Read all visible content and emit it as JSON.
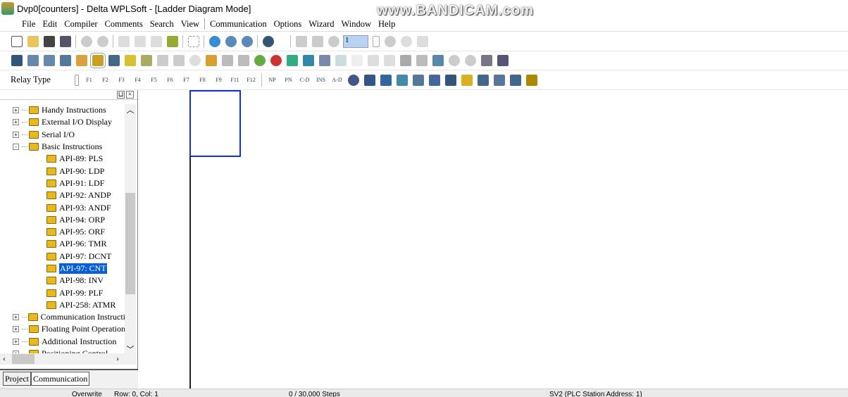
{
  "window": {
    "title": "Dvp0[counters] - Delta WPLSoft - [Ladder Diagram Mode]",
    "watermark": "www.BANDICAM.com"
  },
  "menu": [
    "File",
    "Edit",
    "Compiler",
    "Comments",
    "Search",
    "View",
    "Communication",
    "Options",
    "Wizard",
    "Window",
    "Help"
  ],
  "toolbar": {
    "step_value": "1",
    "relay_type": "Relay Type",
    "fkeys": [
      "F1",
      "F2",
      "F3",
      "F4",
      "F5",
      "F6",
      "F7",
      "F8",
      "F9",
      "F11",
      "F12"
    ],
    "extra_keys": [
      "NP",
      "PN",
      "C-D",
      "INS",
      "A-D"
    ]
  },
  "tree": {
    "items": [
      {
        "label": "Handy Instructions",
        "level": 0,
        "exp": "+"
      },
      {
        "label": "External I/O Display",
        "level": 0,
        "exp": "+"
      },
      {
        "label": "Serial I/O",
        "level": 0,
        "exp": "+"
      },
      {
        "label": "Basic Instructions",
        "level": 0,
        "exp": "-"
      },
      {
        "label": "API-89: PLS",
        "level": 1
      },
      {
        "label": "API-90: LDP",
        "level": 1
      },
      {
        "label": "API-91: LDF",
        "level": 1
      },
      {
        "label": "API-92: ANDP",
        "level": 1
      },
      {
        "label": "API-93: ANDF",
        "level": 1
      },
      {
        "label": "API-94: ORP",
        "level": 1
      },
      {
        "label": "API-95: ORF",
        "level": 1
      },
      {
        "label": "API-96: TMR",
        "level": 1
      },
      {
        "label": "API-97: DCNT",
        "level": 1
      },
      {
        "label": "API-97: CNT",
        "level": 1,
        "selected": true
      },
      {
        "label": "API-98: INV",
        "level": 1
      },
      {
        "label": "API-99: PLF",
        "level": 1
      },
      {
        "label": "API-258: ATMR",
        "level": 1
      },
      {
        "label": "Communication Instructi",
        "level": 0,
        "exp": "+"
      },
      {
        "label": "Floating Point Operation",
        "level": 0,
        "exp": "+"
      },
      {
        "label": "Additional Instruction",
        "level": 0,
        "exp": "+"
      },
      {
        "label": "Positioning Control",
        "level": 0,
        "exp": "+"
      }
    ]
  },
  "tabs": [
    "Project",
    "Communication"
  ],
  "status": {
    "mode": "Overwrite",
    "position": "Row: 0, Col: 1",
    "steps": "0 / 30,000 Steps",
    "plc": "SV2 (PLC Station Address: 1)"
  }
}
